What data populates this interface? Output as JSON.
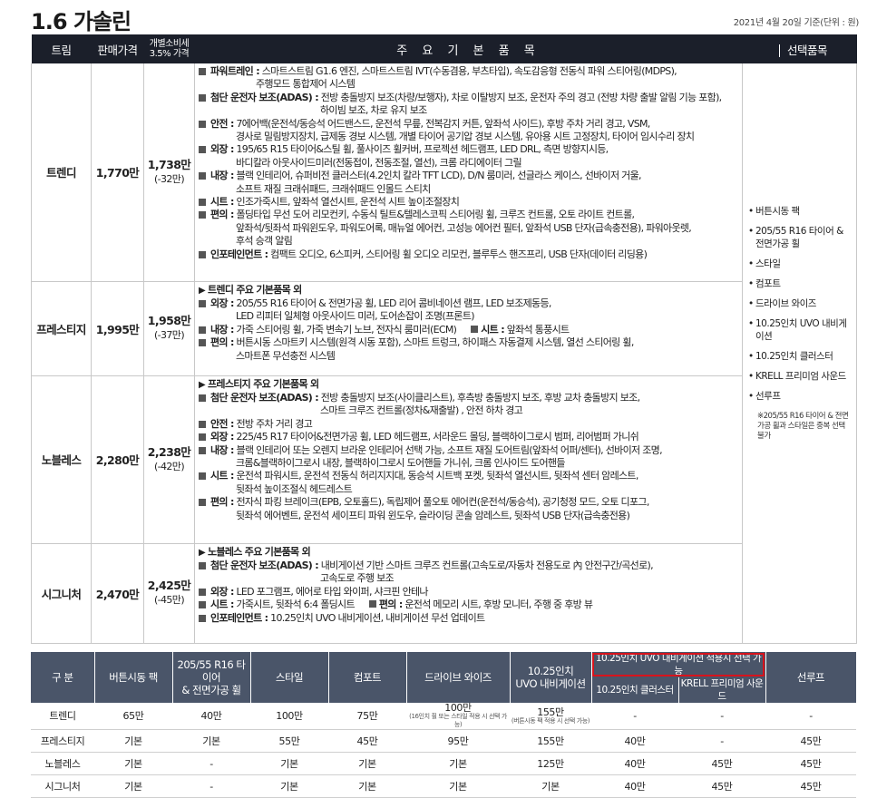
{
  "title": "1.6 가솔린",
  "date_note": "2021년 4월 20일 기준(단위 : 원)",
  "headers": {
    "trim": "트림",
    "price": "판매가격",
    "tax_line1": "개별소비세",
    "tax_line2": "3.5% 가격",
    "basic": "주 요 기 본 품 목",
    "options": "선택품목"
  },
  "rows": [
    {
      "trim": "트렌디",
      "price": "1,770만",
      "tax": "1,738만",
      "tax_diff": "(-32만)",
      "lines": [
        {
          "label": "파워트레인 :",
          "text": " 스마트스트림 G1.6 엔진, 스마트스트림 IVT(수동겸용, 부츠타입), 속도감응형 전동식 파워 스티어링(MDPS),"
        },
        {
          "cont": "주행모드 통합제어 시스템"
        },
        {
          "label": "첨단 운전자 보조(ADAS) :",
          "text": " 전방 충돌방지 보조(차량/보행자), 차로 이탈방지 보조, 운전자 주의 경고 (전방 차량 출발 알림 기능 포함),"
        },
        {
          "cont": "하이빔 보조, 차로 유지 보조"
        },
        {
          "label": "안전 :",
          "text": " 7에어백(운전석/동승석 어드밴스드, 운전석 무릎, 전복감지 커튼, 앞좌석 사이드), 후방 주차 거리 경고, VSM,"
        },
        {
          "cont": "경사로 밀림방지장치, 급제동 경보 시스템, 개별 타이어 공기압 경보 시스템, 유아용 시트 고정장치, 타이어 임시수리 장치"
        },
        {
          "label": "외장 :",
          "text": " 195/65 R15 타이어&스틸 휠, 풀사이즈 휠커버, 프로젝션 헤드램프, LED DRL, 측면 방향지시등,"
        },
        {
          "cont": "바디칼라 아웃사이드미러(전동접이, 전동조절, 열선), 크롬 라디에이터 그릴"
        },
        {
          "label": "내장 :",
          "text": " 블랙 인테리어, 슈퍼비전 클러스터(4.2인치 칼라 TFT LCD), D/N 룸미러, 선글라스 케이스, 선바이저 거울,"
        },
        {
          "cont": "소프트 재질 크래쉬패드, 크래쉬패드 인몰드 스티치"
        },
        {
          "label": "시트 :",
          "text": " 인조가죽시트, 앞좌석 열선시트, 운전석 시트 높이조절장치"
        },
        {
          "label": "편의 :",
          "text": " 폴딩타입 무선 도어 리모컨키, 수동식 틸트&텔레스코픽 스티어링 휠, 크루즈 컨트롤, 오토 라이트 컨트롤,"
        },
        {
          "cont": "앞좌석/뒷좌석 파워윈도우, 파워도어록, 매뉴얼 에어컨, 고성능 에어컨 필터, 앞좌석 USB 단자(급속충전용), 파워아웃렛,"
        },
        {
          "cont": "후석 승객 알림"
        },
        {
          "label": "인포테인먼트 :",
          "text": " 컴팩트 오디오, 6스피커, 스티어링 휠 오디오 리모컨, 블루투스 핸즈프리, USB 단자(데이터 리딩용)"
        }
      ]
    },
    {
      "trim": "프레스티지",
      "price": "1,995만",
      "tax": "1,958만",
      "tax_diff": "(-37만)",
      "head": "트렌디 주요 기본품목 외",
      "lines": [
        {
          "label": "외장 :",
          "text": " 205/55 R16 타이어 & 전면가공 휠, LED 리어 콤비네이션 램프, LED 보조제동등,"
        },
        {
          "cont": "LED 리피터 일체형 아웃사이드 미러, 도어손잡이 조명(프론트)"
        },
        {
          "label": "내장 :",
          "text": " 가죽 스티어링 휠, 가죽 변속기 노브, 전자식 룸미러(ECM)",
          "label2": "시트 :",
          "text2": " 앞좌석 통풍시트"
        },
        {
          "label": "편의 :",
          "text": " 버튼시동 스마트키 시스템(원격 시동 포함), 스마트 트렁크, 하이패스 자동결제 시스템, 열선 스티어링 휠,"
        },
        {
          "cont": "스마트폰 무선충전 시스템"
        }
      ]
    },
    {
      "trim": "노블레스",
      "price": "2,280만",
      "tax": "2,238만",
      "tax_diff": "(-42만)",
      "head": "프레스티지 주요 기본품목 외",
      "lines": [
        {
          "label": "첨단 운전자 보조(ADAS) :",
          "text": " 전방 충돌방지 보조(사이클리스트), 후측방 충돌방지 보조, 후방 교차 충돌방지 보조,"
        },
        {
          "cont": "스마트 크루즈 컨트롤(정차&재출발) , 안전 하차 경고"
        },
        {
          "label": "안전 :",
          "text": " 전방 주차 거리 경고"
        },
        {
          "label": "외장 :",
          "text": " 225/45 R17 타이어&전면가공 휠, LED 헤드램프, 서라운드 몰딩, 블랙하이그로시 범퍼, 리어범퍼 가니쉬"
        },
        {
          "label": "내장 :",
          "text": " 블랙 인테리어 또는 오렌지 브라운 인테리어 선택 가능, 소프트 재질 도어트림(앞좌석 어퍼/센터), 선바이저 조명,"
        },
        {
          "cont": "크롬&블랙하이그로시 내장, 블랙하이그로시 도어핸들 가니쉬, 크롬 인사이드 도어핸들"
        },
        {
          "label": "시트 :",
          "text": " 운전석 파워시트, 운전석 전동식 허리지지대, 동승석 시트백 포켓, 뒷좌석 열선시트, 뒷좌석 센터 암레스트,"
        },
        {
          "cont": "뒷좌석 높이조절식 헤드레스트"
        },
        {
          "label": "편의 :",
          "text": " 전자식 파킹 브레이크(EPB, 오토홀드), 독립제어 풀오토 에어컨(운전석/동승석), 공기청정 모드, 오토 디포그,"
        },
        {
          "cont": "뒷좌석 에어벤트, 운전석 세이프티 파워 윈도우, 슬라이딩 콘솔 암레스트, 뒷좌석 USB 단자(급속충전용)"
        }
      ]
    },
    {
      "trim": "시그니처",
      "price": "2,470만",
      "tax": "2,425만",
      "tax_diff": "(-45만)",
      "head": "노블레스 주요 기본품목 외",
      "lines": [
        {
          "label": "첨단 운전자 보조(ADAS) :",
          "text": " 내비게이션 기반 스마트 크루즈 컨트롤(고속도로/자동차 전용도로 內 안전구간/곡선로),"
        },
        {
          "cont": "고속도로 주행 보조"
        },
        {
          "label": "외장 :",
          "text": " LED 포그램프, 에어로 타입 와이퍼, 샤크핀 안테나"
        },
        {
          "label": "시트 :",
          "text": " 가죽시트, 뒷좌석 6:4 폴딩시트",
          "label2": "편의 :",
          "text2": " 운전석 메모리 시트, 후방 모니터, 주행 중 후방 뷰"
        },
        {
          "label": "인포테인먼트 :",
          "text": " 10.25인치 UVO 내비게이션, 내비게이션 무선 업데이트"
        }
      ]
    }
  ],
  "options": {
    "items": [
      "버튼시동 팩",
      "205/55 R16 타이어 & 전면가공 휠",
      "스타일",
      "컴포트",
      "드라이브 와이즈",
      "10.25인치 UVO 내비게이션",
      "10.25인치 클러스터",
      "KRELL 프리미엄 사운드",
      "선루프"
    ],
    "note": "※205/55 R16 타이어 & 전면가공 휠과 스타일은 중복 선택 불가"
  },
  "option_table": {
    "headers": {
      "group": "구 분",
      "button": "버튼시동 팩",
      "tire_l1": "205/55 R16 타이어",
      "tire_l2": "& 전면가공 휠",
      "style": "스타일",
      "comfort": "컴포트",
      "drive": "드라이브 와이즈",
      "navi_l1": "10.25인치",
      "navi_l2": "UVO 내비게이션",
      "navi_group": "10.25인치 UVO 내비게이션 적용시 선택 가능",
      "cluster": "10.25인치 클러스터",
      "krell": "KRELL 프리미엄 사운드",
      "sunroof": "선루프"
    },
    "rows": [
      {
        "trim": "트렌디",
        "button": "65만",
        "tire": "40만",
        "style": "100만",
        "comfort": "75만",
        "drive": "100만",
        "drive_note": "(16인치 휠 또는 스타일 적용 시 선택 가능)",
        "navi": "155만",
        "navi_note": "(버튼시동 팩 적용 시 선택 가능)",
        "cluster": "-",
        "krell": "-",
        "sunroof": "-"
      },
      {
        "trim": "프레스티지",
        "button": "기본",
        "tire": "기본",
        "style": "55만",
        "comfort": "45만",
        "drive": "95만",
        "drive_note": "",
        "navi": "155만",
        "navi_note": "",
        "cluster": "40만",
        "krell": "-",
        "sunroof": "45만"
      },
      {
        "trim": "노블레스",
        "button": "기본",
        "tire": "-",
        "style": "기본",
        "comfort": "기본",
        "drive": "기본",
        "drive_note": "",
        "navi": "125만",
        "navi_note": "",
        "cluster": "40만",
        "krell": "45만",
        "sunroof": "45만"
      },
      {
        "trim": "시그니처",
        "button": "기본",
        "tire": "-",
        "style": "기본",
        "comfort": "기본",
        "drive": "기본",
        "drive_note": "",
        "navi": "기본",
        "navi_note": "",
        "cluster": "40만",
        "krell": "45만",
        "sunroof": "45만"
      }
    ]
  },
  "colors": {
    "header_dark": "#1b1f2a",
    "header_grey": "#4a5569",
    "highlight_red": "#d8131c"
  }
}
